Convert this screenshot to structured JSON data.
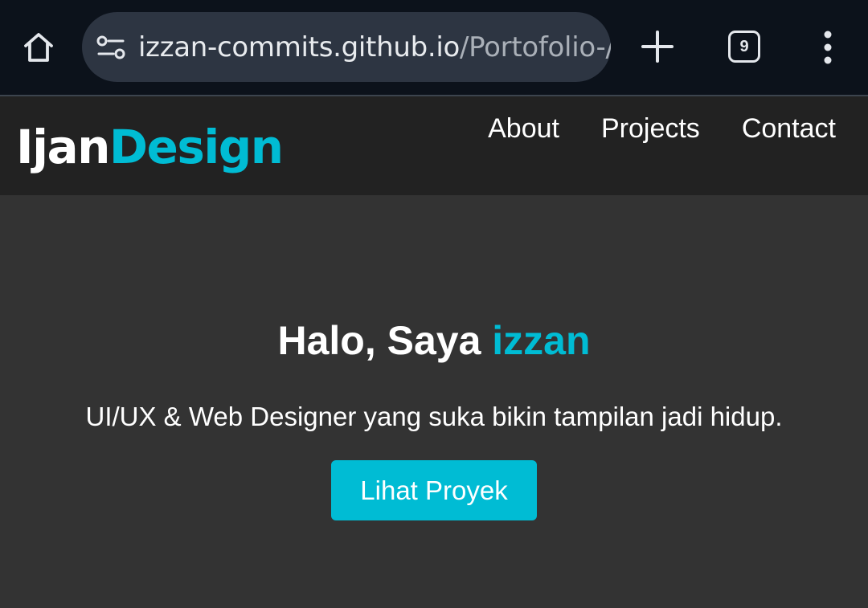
{
  "browser": {
    "url_host": "izzan-commits.github.io",
    "url_path": "/Portofolio-/",
    "tab_count": "9",
    "icons": {
      "home": "home-icon",
      "site_info": "tune-icon",
      "new_tab": "plus-icon",
      "menu": "more-vert-icon"
    }
  },
  "site": {
    "logo_part1": "Ijan",
    "logo_part2": "Design",
    "nav": [
      {
        "label": "About"
      },
      {
        "label": "Projects"
      },
      {
        "label": "Contact"
      }
    ]
  },
  "hero": {
    "title_prefix": "Halo, Saya ",
    "title_name": "izzan",
    "subtitle": "UI/UX & Web Designer yang suka bikin tampilan jadi hidup.",
    "cta_label": "Lihat Proyek"
  },
  "colors": {
    "accent": "#00bcd4",
    "header_bg": "#222222",
    "hero_bg": "#333333",
    "browser_bar": "#0c121b"
  }
}
